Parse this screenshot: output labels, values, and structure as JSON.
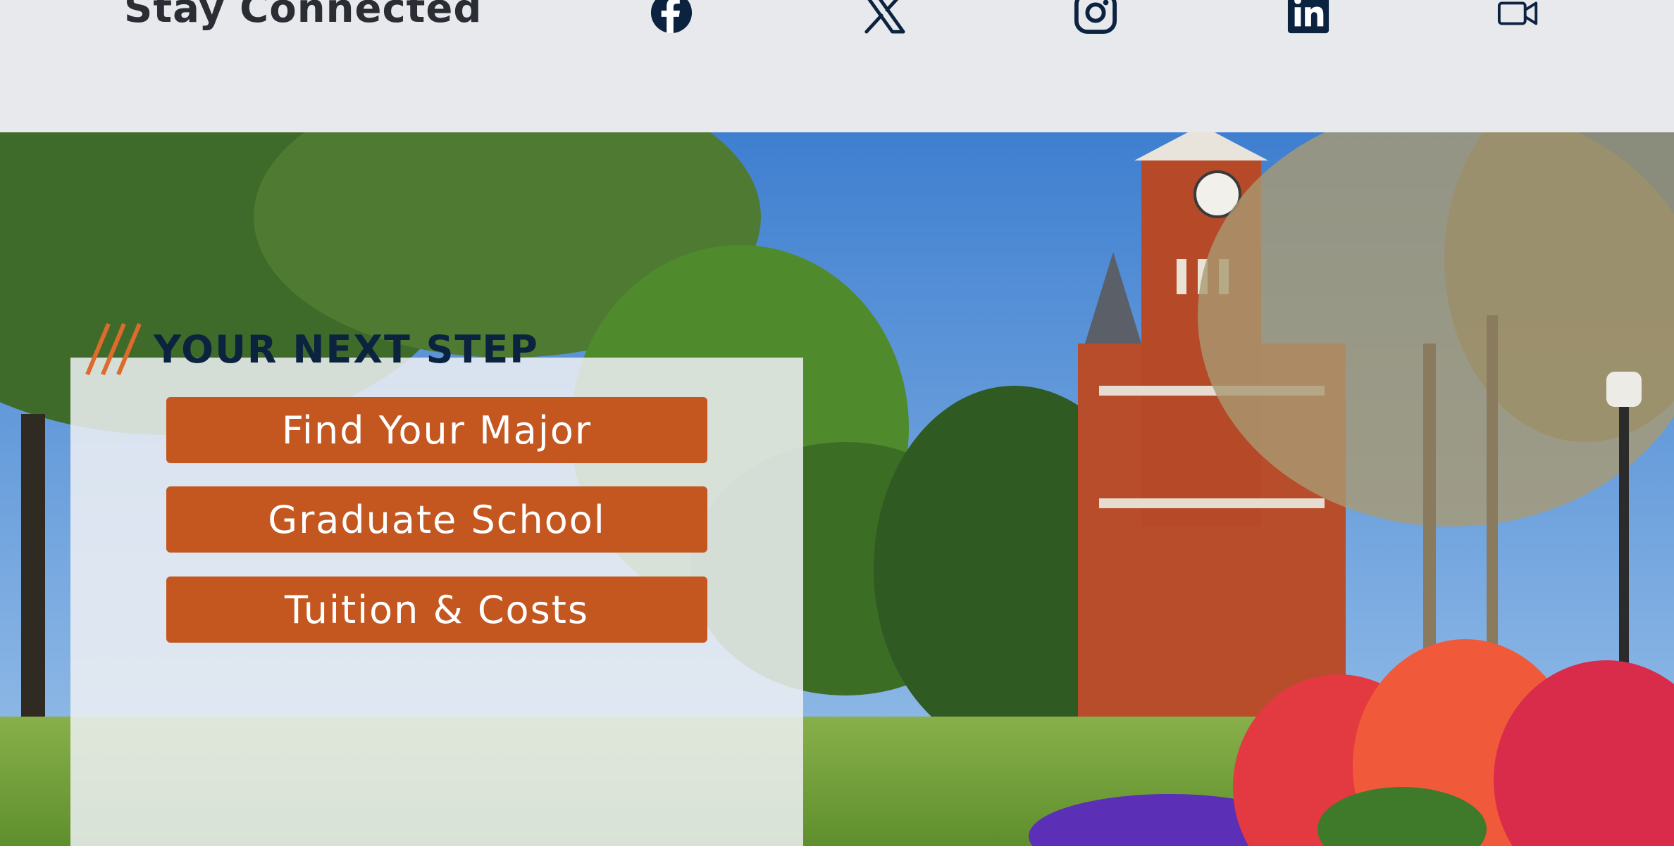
{
  "social": {
    "title": "Stay Connected",
    "icon_color": "#0c2340",
    "icons": [
      "facebook-icon",
      "x-icon",
      "instagram-icon",
      "linkedin-icon",
      "video-icon"
    ]
  },
  "next_step": {
    "heading": "YOUR NEXT STEP",
    "accent_color": "#dd6b2b",
    "heading_color": "#0c2340",
    "button_color": "#c4561f",
    "buttons": [
      {
        "label": "Find Your Major"
      },
      {
        "label": "Graduate School"
      },
      {
        "label": "Tuition & Costs"
      }
    ]
  },
  "hero": {
    "image": "campus-clock-tower-photo"
  }
}
